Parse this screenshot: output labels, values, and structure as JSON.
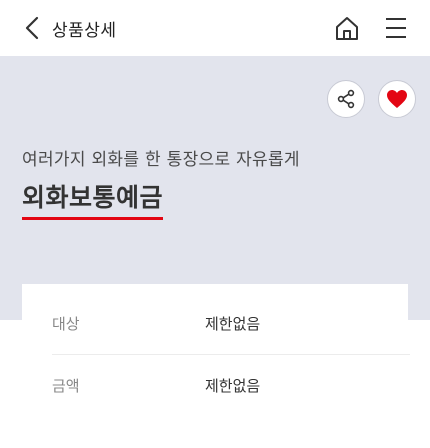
{
  "header": {
    "title": "상품상세",
    "back_icon": "chevron-left-icon",
    "home_icon": "home-icon",
    "menu_icon": "hamburger-menu-icon"
  },
  "hero": {
    "subtitle": "여러가지 외화를 한 통장으로 자유롭게",
    "title": "외화보통예금",
    "share_icon": "share-icon",
    "favorite_icon": "heart-icon",
    "background_color": "#e2e4ed",
    "accent_color": "#e30613"
  },
  "info": {
    "rows": [
      {
        "label": "대상",
        "value": "제한없음"
      },
      {
        "label": "금액",
        "value": "제한없음"
      }
    ]
  }
}
